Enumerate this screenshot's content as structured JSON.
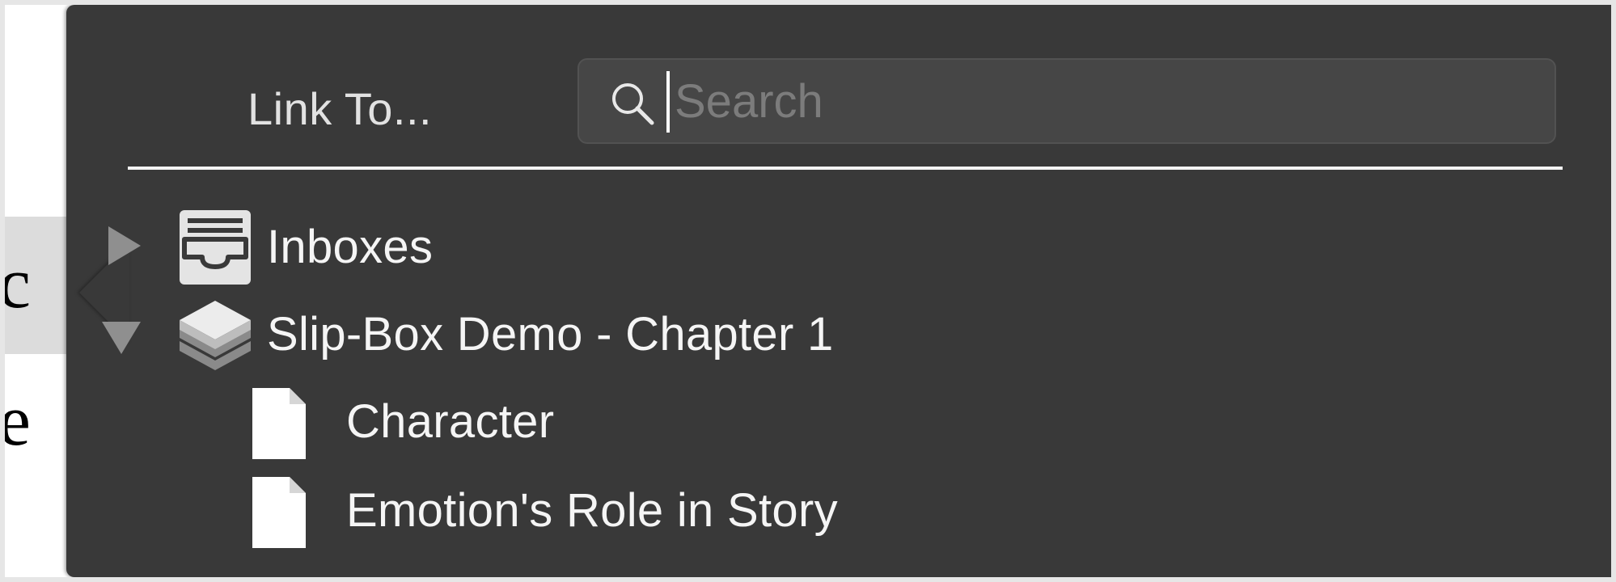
{
  "popover": {
    "title": "Link To...",
    "search": {
      "placeholder": "Search",
      "value": ""
    }
  },
  "tree": {
    "items": [
      {
        "label": "Inboxes",
        "icon": "inbox-tray-icon",
        "expanded": false
      },
      {
        "label": "Slip-Box Demo - Chapter 1",
        "icon": "layers-stack-icon",
        "expanded": true,
        "children": [
          {
            "label": "Character",
            "icon": "document-icon"
          },
          {
            "label": "Emotion's Role in Story",
            "icon": "document-icon"
          }
        ]
      }
    ]
  },
  "colors": {
    "popover_bg": "#393939",
    "search_bg": "#464646",
    "text": "#f5f5f5",
    "placeholder": "#7c7c7c",
    "disclosure": "#8f8f8f"
  }
}
